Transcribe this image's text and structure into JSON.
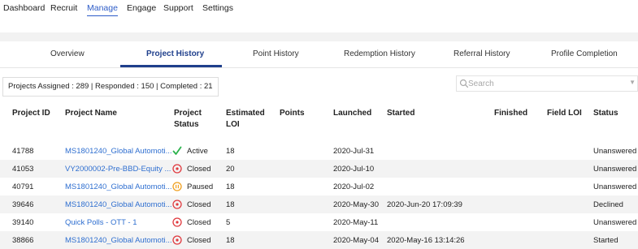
{
  "topnav": [
    {
      "label": "Dashboard",
      "active": false
    },
    {
      "label": "Recruit",
      "active": false
    },
    {
      "label": "Manage",
      "active": true
    },
    {
      "label": "Engage",
      "active": false
    },
    {
      "label": "Support",
      "active": false
    },
    {
      "label": "Settings",
      "active": false
    }
  ],
  "tabs": [
    {
      "label": "Overview",
      "active": false
    },
    {
      "label": "Project History",
      "active": true
    },
    {
      "label": "Point History",
      "active": false
    },
    {
      "label": "Redemption History",
      "active": false
    },
    {
      "label": "Referral History",
      "active": false
    },
    {
      "label": "Profile Completion",
      "active": false
    }
  ],
  "summary": "Projects Assigned : 289 |  Responded : 150 |  Completed : 21",
  "search": {
    "placeholder": "Search"
  },
  "table": {
    "headers": {
      "project_id": "Project ID",
      "project_name": "Project Name",
      "project_status": "Project Status",
      "estimated_loi": "Estimated LOI",
      "points": "Points",
      "launched": "Launched",
      "started": "Started",
      "finished": "Finished",
      "field_loi": "Field LOI",
      "status": "Status"
    },
    "rows": [
      {
        "project_id": "41788",
        "project_name": "MS1801240_Global Automoti...",
        "project_status": "Active",
        "status_icon": "checkmark-icon",
        "estimated_loi": "18",
        "points": "",
        "launched": "2020-Jul-31",
        "started": "",
        "finished": "",
        "field_loi": "",
        "status": "Unanswered"
      },
      {
        "project_id": "41053",
        "project_name": "VY2000002-Pre-BBD-Equity ...",
        "project_status": "Closed",
        "status_icon": "closed-icon",
        "estimated_loi": "20",
        "points": "",
        "launched": "2020-Jul-10",
        "started": "",
        "finished": "",
        "field_loi": "",
        "status": "Unanswered"
      },
      {
        "project_id": "40791",
        "project_name": "MS1801240_Global Automoti...",
        "project_status": "Paused",
        "status_icon": "pause-icon",
        "estimated_loi": "18",
        "points": "",
        "launched": "2020-Jul-02",
        "started": "",
        "finished": "",
        "field_loi": "",
        "status": "Unanswered"
      },
      {
        "project_id": "39646",
        "project_name": "MS1801240_Global Automoti...",
        "project_status": "Closed",
        "status_icon": "closed-icon",
        "estimated_loi": "18",
        "points": "",
        "launched": "2020-May-30",
        "started": "2020-Jun-20 17:09:39",
        "finished": "",
        "field_loi": "",
        "status": "Declined"
      },
      {
        "project_id": "39140",
        "project_name": "Quick Polls - OTT - 1",
        "project_status": "Closed",
        "status_icon": "closed-icon",
        "estimated_loi": "5",
        "points": "",
        "launched": "2020-May-11",
        "started": "",
        "finished": "",
        "field_loi": "",
        "status": "Unanswered"
      },
      {
        "project_id": "38866",
        "project_name": "MS1801240_Global Automoti...",
        "project_status": "Closed",
        "status_icon": "closed-icon",
        "estimated_loi": "18",
        "points": "",
        "launched": "2020-May-04",
        "started": "2020-May-16 13:14:26",
        "finished": "",
        "field_loi": "",
        "status": "Started"
      }
    ]
  },
  "colors": {
    "accent": "#1f3f8c",
    "link": "#2f6fd0",
    "active": "#2bb24c",
    "closed": "#e0393e",
    "paused": "#f0a020"
  }
}
